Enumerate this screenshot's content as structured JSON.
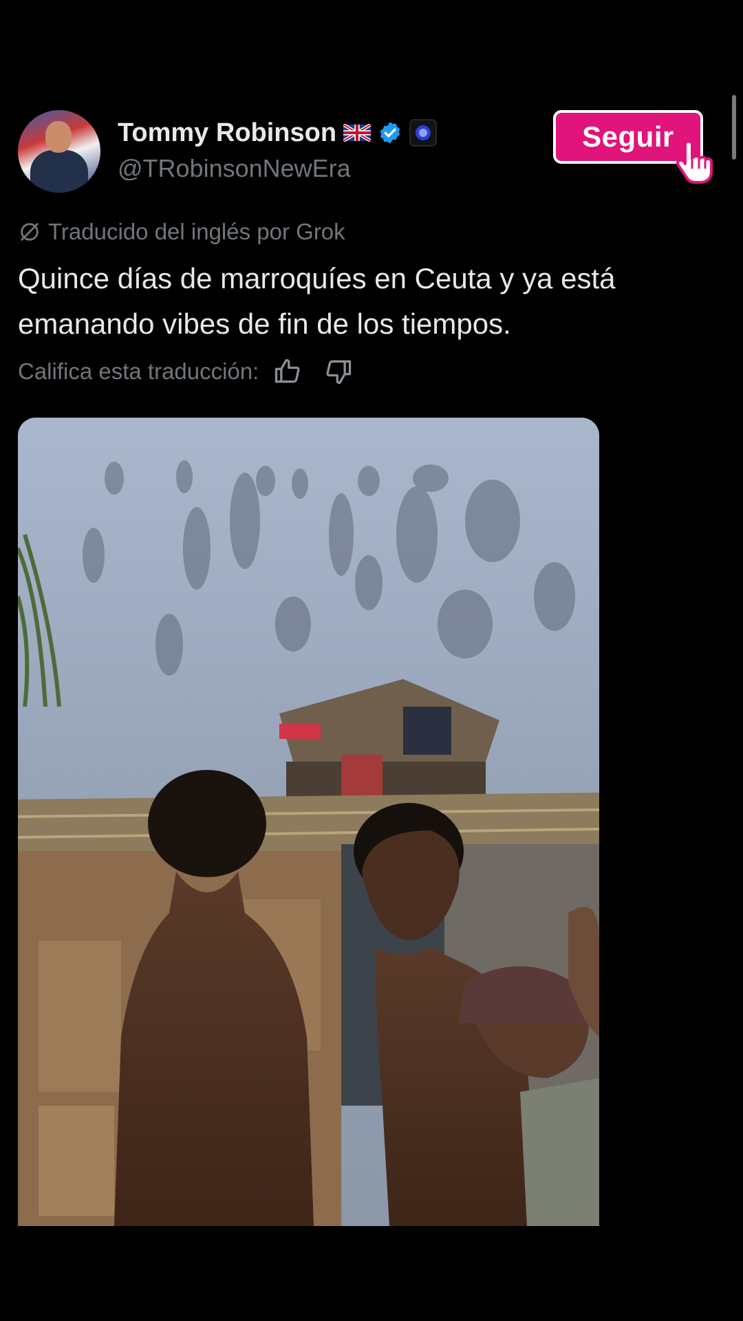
{
  "account": {
    "name": "Tommy Robinson",
    "handle": "@TRobinsonNewEra"
  },
  "follow_button": {
    "label": "Seguir"
  },
  "translation": {
    "notice": "Traducido del inglés por Grok",
    "rate_prompt": "Califica esta traducción:"
  },
  "tweet": {
    "text": "Quince días de marroquíes en Ceuta y ya está emanando vibes de fin de los tiempos."
  },
  "colors": {
    "background": "#000000",
    "primary_text": "#e7e9ea",
    "secondary_text": "#71767b",
    "verified_blue": "#1d9bf0",
    "follow_button": "#e0147a"
  },
  "icons": [
    "uk-flag-icon",
    "verified-badge-icon",
    "affiliate-badge-icon",
    "grok-translate-icon",
    "thumbs-up-icon",
    "thumbs-down-icon",
    "pointer-hand-icon"
  ]
}
